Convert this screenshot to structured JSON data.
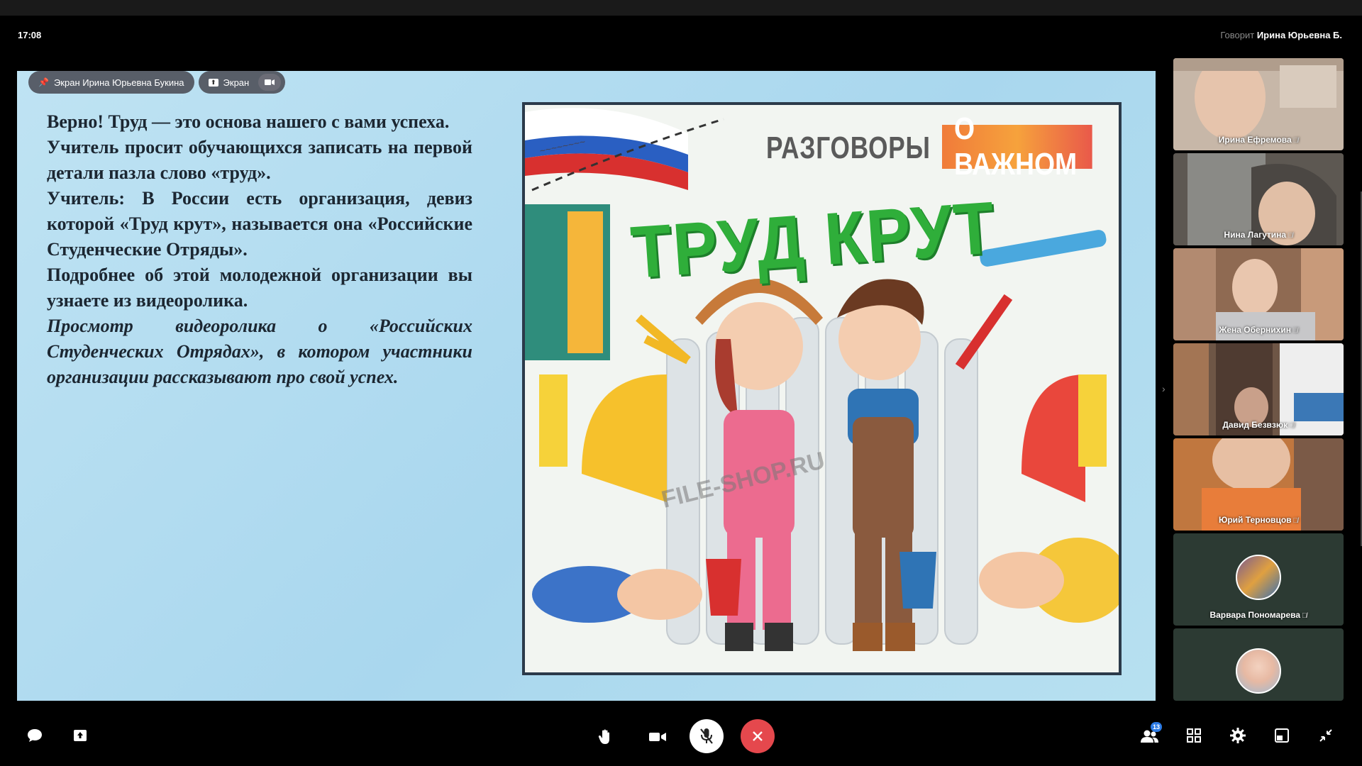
{
  "status": {
    "time": "17:08",
    "speaking_label": "Говорит",
    "speaker_name": "Ирина Юрьевна Б."
  },
  "screen_share": {
    "owner_chip": "Экран Ирина Юрьевна Букина",
    "view_chip": "Экран",
    "slide": {
      "paragraphs": [
        "Верно! Труд — это основа нашего с вами успеха.",
        "Учитель просит обучающихся записать на первой детали пазла слово «труд».",
        "Учитель: В России есть организация, девиз которой «Труд крут», называется она «Российские Студенческие Отряды».",
        "Подробнее об этой молодежной организации вы узнаете из видеоролика."
      ],
      "italic_paragraph": "Просмотр видеоролика о «Российских Студенческих Отрядах», в котором участники организации рассказывают про свой успех.",
      "poster": {
        "header_left": "РАЗГОВОРЫ",
        "header_right": "О ВАЖНОМ",
        "headline": "ТРУД КРУТ",
        "watermark": "FILE-SHOP.RU"
      }
    }
  },
  "participants": [
    {
      "name": "Ирина Ефремова",
      "bg": "#b9a99b"
    },
    {
      "name": "Нина Лагутина",
      "bg": "#6f6a63"
    },
    {
      "name": "Жена Обернихин",
      "bg": "#9c7b63"
    },
    {
      "name": "Давид Безвзюк",
      "bg": "#7a6253"
    },
    {
      "name": "Юрий Терновцов",
      "bg": "#b5683f"
    },
    {
      "name": "Варвара Пономарева",
      "bg": "#2d3b34"
    },
    {
      "name": "",
      "bg": "#2d3b34"
    }
  ],
  "toolbar": {
    "participants_count": "13"
  },
  "colors": {
    "end_call": "#e5484d",
    "mic_button": "#ffffff",
    "accent": "#2c7be5"
  }
}
